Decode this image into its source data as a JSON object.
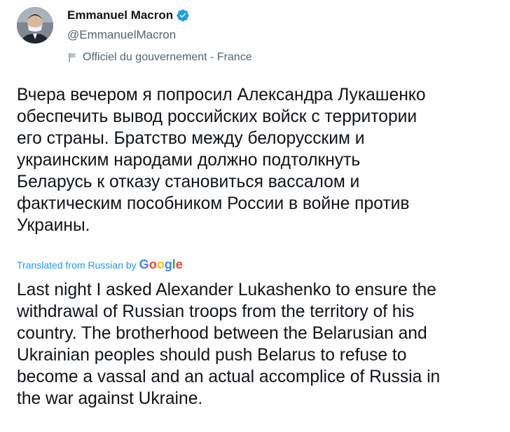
{
  "author": {
    "display_name": "Emmanuel Macron",
    "handle": "@EmmanuelMacron",
    "affiliation": "Officiel du gouvernement - France",
    "verified_icon": "verified-badge-icon",
    "affiliation_icon": "flag-icon"
  },
  "tweet": {
    "original_text": "Вчера вечером я попросил Александра Лукашенко\nобеспечить вывод российских войск с территории\nего страны. Братство между белорусским и\nукраинским народами должно подтолкнуть\nБеларусь к отказу становиться вассалом и\nфактическим пособником России в войне против\nУкраины.",
    "translation_label": "Translated from Russian by",
    "translation_provider": "Google",
    "translated_text": "Last night I asked Alexander Lukashenko to ensure the\nwithdrawal of Russian troops from the territory of his\ncountry. The brotherhood between the Belarusian and\nUkrainian peoples should push Belarus to refuse to\nbecome a vassal and an actual accomplice of Russia in\nthe war against Ukraine."
  },
  "colors": {
    "link_blue": "#1d9bf0",
    "secondary_text": "#536471",
    "primary_text": "#0f1419"
  }
}
